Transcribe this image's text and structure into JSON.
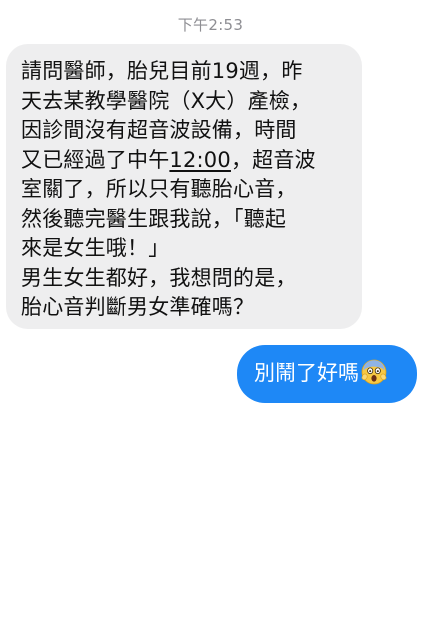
{
  "conversation": {
    "timestamp": "下午2:53",
    "incoming_message": {
      "lines": [
        "請問醫師，胎兒目前19週，昨",
        "天去某教學醫院（X大）產檢，",
        "因診間沒有超音波設備，時間",
        "又已經過了中午",
        "室關了，所以只有聽胎心音，",
        "然後聽完醫生跟我說，「聽起",
        "來是女生哦！」",
        "男生女生都好，我想問的是，",
        "胎心音判斷男女準確嗎？"
      ],
      "underlined_time": "12:00",
      "after_time": "，超音波"
    },
    "outgoing_message": {
      "text": "別鬧了好嗎",
      "emoji": "face-screaming-in-fear-icon"
    }
  }
}
